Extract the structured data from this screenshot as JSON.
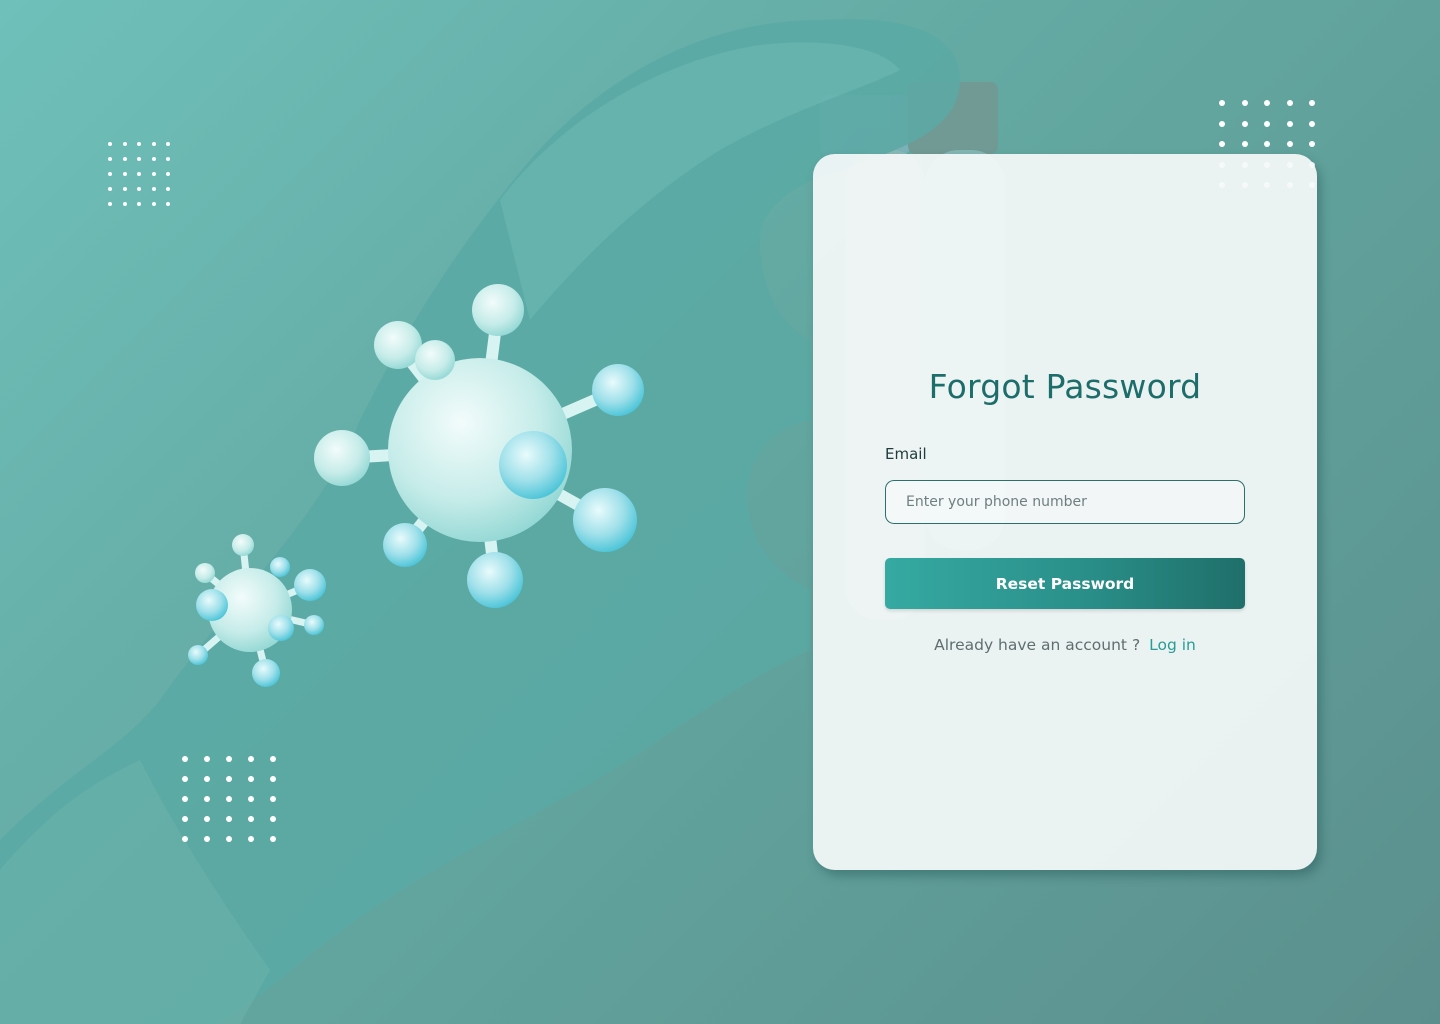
{
  "page": {
    "background_colors": [
      "#6fc0ba",
      "#5b8f8d"
    ]
  },
  "decor": {
    "glove_icon": "gloved-hand-holding-tubes",
    "virus_icon": "virus-icon"
  },
  "form": {
    "title": "Forgot Password",
    "email_label": "Email",
    "email_placeholder": "Enter your phone number",
    "email_value": "",
    "submit_label": "Reset Password",
    "footer_text": "Already have an account ?",
    "login_link": "Log in"
  },
  "colors": {
    "title": "#1d6d6b",
    "button_start": "#35aaa2",
    "button_end": "#1f6f6a",
    "link": "#2a9c96",
    "card": "#f5f9f9"
  }
}
